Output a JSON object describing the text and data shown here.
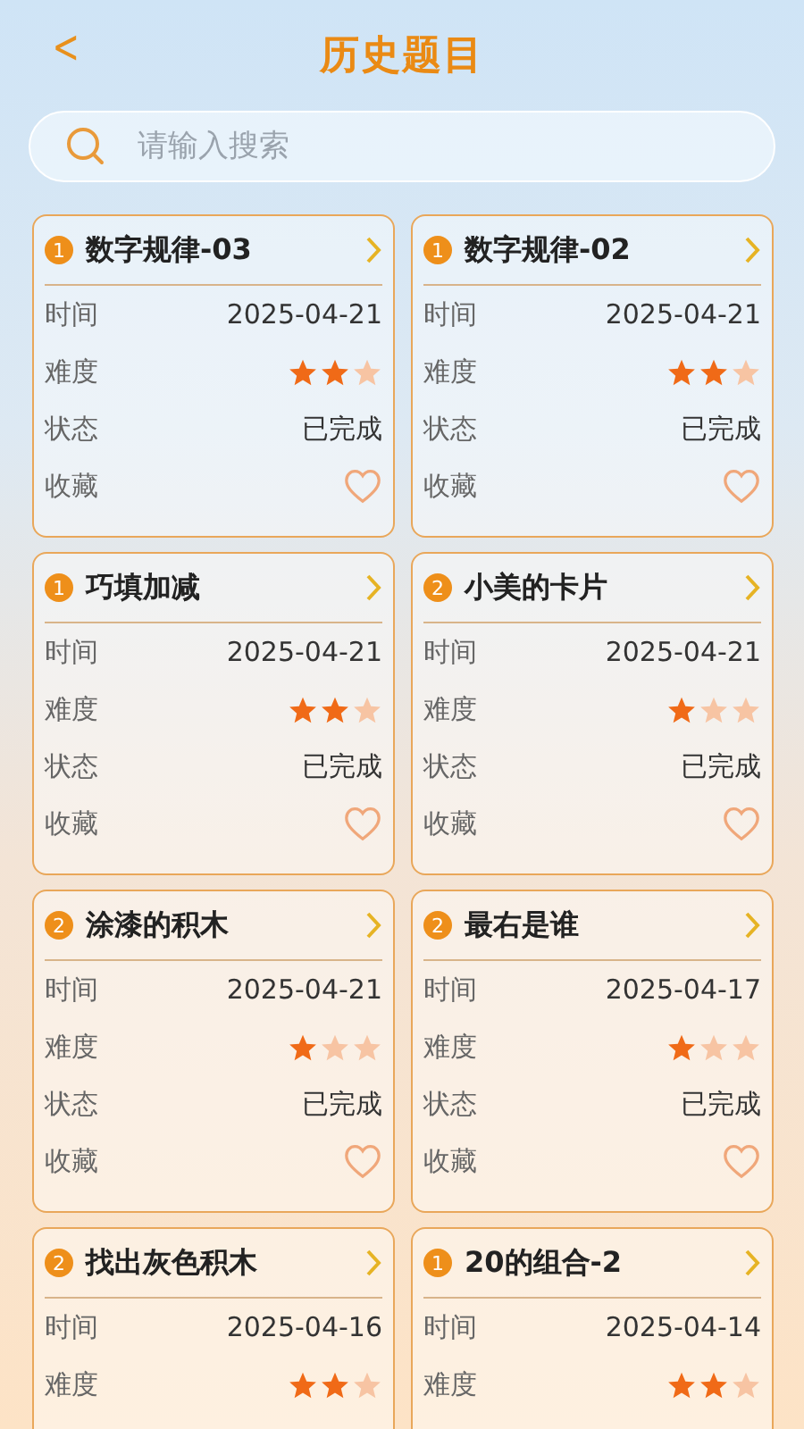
{
  "header": {
    "back": "<",
    "title": "历史题目"
  },
  "search": {
    "placeholder": "请输入搜索"
  },
  "cards": [
    {
      "number": "1",
      "title": "数字规律-03",
      "rows": [
        {
          "label": "时间",
          "kind": "text",
          "value": "2025-04-21"
        },
        {
          "label": "难度",
          "kind": "stars",
          "stars": 2
        },
        {
          "label": "状态",
          "kind": "text",
          "value": "已完成"
        },
        {
          "label": "收藏",
          "kind": "favorite",
          "favorited": false
        }
      ]
    },
    {
      "number": "1",
      "title": "数字规律-02",
      "rows": [
        {
          "label": "时间",
          "kind": "text",
          "value": "2025-04-21"
        },
        {
          "label": "难度",
          "kind": "stars",
          "stars": 2
        },
        {
          "label": "状态",
          "kind": "text",
          "value": "已完成"
        },
        {
          "label": "收藏",
          "kind": "favorite",
          "favorited": false
        }
      ]
    },
    {
      "number": "1",
      "title": "巧填加减",
      "rows": [
        {
          "label": "时间",
          "kind": "text",
          "value": "2025-04-21"
        },
        {
          "label": "难度",
          "kind": "stars",
          "stars": 2
        },
        {
          "label": "状态",
          "kind": "text",
          "value": "已完成"
        },
        {
          "label": "收藏",
          "kind": "favorite",
          "favorited": false
        }
      ]
    },
    {
      "number": "2",
      "title": "小美的卡片",
      "rows": [
        {
          "label": "时间",
          "kind": "text",
          "value": "2025-04-21"
        },
        {
          "label": "难度",
          "kind": "stars",
          "stars": 1
        },
        {
          "label": "状态",
          "kind": "text",
          "value": "已完成"
        },
        {
          "label": "收藏",
          "kind": "favorite",
          "favorited": false
        }
      ]
    },
    {
      "number": "2",
      "title": "涂漆的积木",
      "rows": [
        {
          "label": "时间",
          "kind": "text",
          "value": "2025-04-21"
        },
        {
          "label": "难度",
          "kind": "stars",
          "stars": 1
        },
        {
          "label": "状态",
          "kind": "text",
          "value": "已完成"
        },
        {
          "label": "收藏",
          "kind": "favorite",
          "favorited": false
        }
      ]
    },
    {
      "number": "2",
      "title": "最右是谁",
      "rows": [
        {
          "label": "时间",
          "kind": "text",
          "value": "2025-04-17"
        },
        {
          "label": "难度",
          "kind": "stars",
          "stars": 1
        },
        {
          "label": "状态",
          "kind": "text",
          "value": "已完成"
        },
        {
          "label": "收藏",
          "kind": "favorite",
          "favorited": false
        }
      ]
    },
    {
      "number": "2",
      "title": "找出灰色积木",
      "rows": [
        {
          "label": "时间",
          "kind": "text",
          "value": "2025-04-16"
        },
        {
          "label": "难度",
          "kind": "stars",
          "stars": 2
        }
      ]
    },
    {
      "number": "1",
      "title": "20的组合-2",
      "rows": [
        {
          "label": "时间",
          "kind": "text",
          "value": "2025-04-14"
        },
        {
          "label": "难度",
          "kind": "stars",
          "stars": 2
        }
      ]
    }
  ]
}
